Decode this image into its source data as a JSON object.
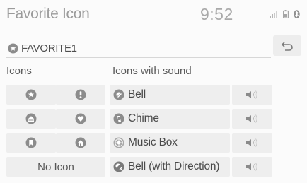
{
  "header": {
    "title": "Favorite Icon",
    "clock": "9:52"
  },
  "status_icons": [
    "signal-icon",
    "battery-icon",
    "bluetooth-icon"
  ],
  "name_field": {
    "icon": "star-icon",
    "value": "FAVORITE1"
  },
  "back_icon": "return-arrow-icon",
  "icons_section": {
    "label": "Icons",
    "icons": [
      "star-icon",
      "exclamation-icon",
      "home-icon",
      "heart-icon",
      "bookmark-icon",
      "house-icon"
    ],
    "no_icon_label": "No Icon"
  },
  "sound_section": {
    "label": "Icons with sound",
    "items": [
      {
        "label": "Bell",
        "icon": "bell-icon"
      },
      {
        "label": "Chime",
        "icon": "chime-icon"
      },
      {
        "label": "Music Box",
        "icon": "music-box-icon"
      },
      {
        "label": "Bell (with Direction)",
        "icon": "bell-direction-icon"
      }
    ],
    "play_icon": "speaker-icon"
  },
  "colors": {
    "background": "#fbfbfb",
    "button": "#eeeeee",
    "icon": "#8c8c8c",
    "text": "#4a4a4a"
  }
}
